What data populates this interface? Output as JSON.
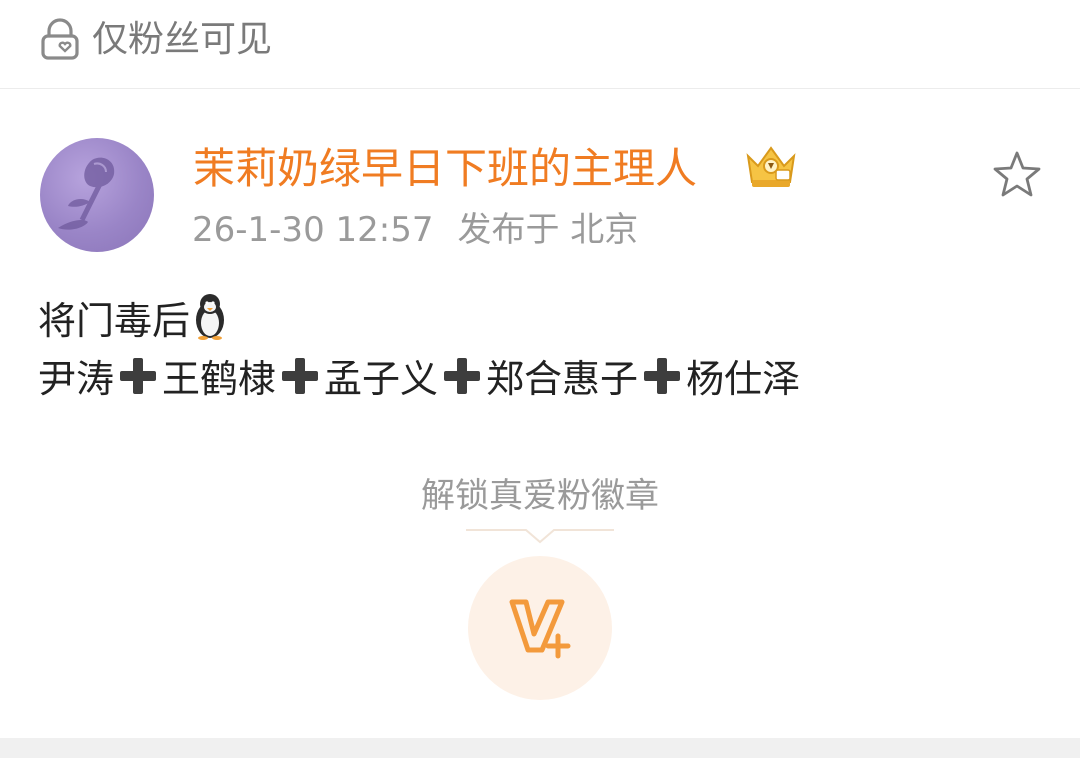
{
  "visibility": {
    "label": "仅粉丝可见",
    "icon": "lock-heart-icon"
  },
  "post": {
    "author": {
      "name": "茉莉奶绿早日下班的主理人",
      "name_color": "#f07c22",
      "badge_icon": "crown-badge-icon",
      "avatar_desc_icon": "rose-avatar"
    },
    "time": "26-1-30 12:57",
    "location": "发布于 北京",
    "content": {
      "line1_text": "将门毒后",
      "line1_emoji": "penguin-emoji",
      "line2_items": [
        "尹涛",
        "王鹤棣",
        "孟子义",
        "郑合惠子",
        "杨仕泽"
      ],
      "separator_emoji": "plus-emoji"
    },
    "favorite_icon": "star-icon"
  },
  "unlock": {
    "label": "解锁真爱粉徽章",
    "badge_icon": "v-plus-icon",
    "accent": "#f39a3c"
  }
}
